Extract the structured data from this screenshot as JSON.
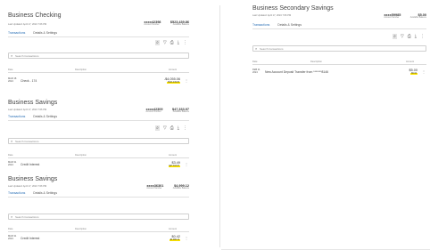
{
  "icons": [
    "search-icon",
    "filter-icon",
    "print-icon",
    "download-icon",
    "more-icon"
  ],
  "table_headers": {
    "date": "Date",
    "description": "Description",
    "amount": "Amount"
  },
  "search_placeholder": "Search transactions",
  "left_accounts": [
    {
      "name": "Business Checking",
      "updated": "Last Updated: April 17, 2024 7:06 PM",
      "account_number": "xxxx42398",
      "account_caption": "Account Number",
      "balance": "$523,439.86",
      "balance_caption": "Available Balance",
      "tabs": [
        "Transactions",
        "Details & Settings"
      ],
      "rows": [
        {
          "date": "MAR 18\n2024",
          "description": "Check - 174",
          "amount": "-$4,055.06",
          "running": "$523,439.86"
        }
      ]
    },
    {
      "name": "Business Savings",
      "updated": "Last Updated: April 17, 2024 7:06 PM",
      "account_number": "xxxx42309",
      "account_caption": "Account Number",
      "balance": "$47,333.97",
      "balance_caption": "Available Balance",
      "tabs": [
        "Transactions",
        "Details & Settings"
      ],
      "rows": [
        {
          "date": "MAR 31\n2024",
          "description": "Credit Interest",
          "amount": "$3.49",
          "running": "$47,333.97"
        }
      ]
    },
    {
      "name": "Business Savings",
      "updated": "Last Updated: April 17, 2024 7:06 PM",
      "account_number": "xxxx36301",
      "account_caption": "Account Number",
      "balance": "$4,999.12",
      "balance_caption": "Available Balance",
      "tabs": [
        "Transactions",
        "Details & Settings"
      ],
      "rows": [
        {
          "date": "MAR 31\n2024",
          "description": "Credit Interest",
          "amount": "$0.42",
          "running": "$4,999.12"
        }
      ]
    }
  ],
  "right_account": {
    "name": "Business Secondary Savings",
    "updated": "Last Updated: April 17, 2024 7:06 PM",
    "account_number": "xxxx59985",
    "account_caption": "Account Number",
    "balance": "$5.00",
    "balance_caption": "Available Balance",
    "tabs": [
      "Transactions",
      "Details & Settings"
    ],
    "rows": [
      {
        "date": "FEB 11\n2024",
        "description": "New Account Deposit Transfer from *******8146",
        "amount": "$5.00",
        "running": "$5.00"
      }
    ]
  }
}
